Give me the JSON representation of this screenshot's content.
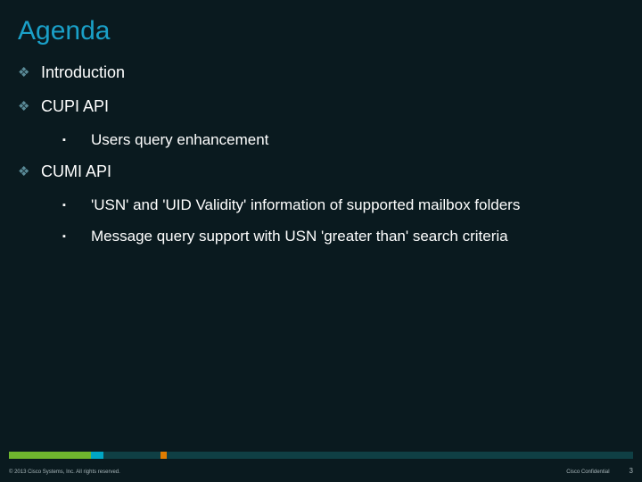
{
  "title": "Agenda",
  "items": [
    {
      "label": "Introduction"
    },
    {
      "label": "CUPI API",
      "children": [
        {
          "label": "Users query enhancement"
        }
      ]
    },
    {
      "label": "CUMI API",
      "children": [
        {
          "label": "'USN' and 'UID Validity' information of supported mailbox folders"
        },
        {
          "label": "Message query support with USN 'greater than' search criteria"
        }
      ]
    }
  ],
  "footer": {
    "copyright": "© 2013 Cisco Systems, Inc. All rights reserved.",
    "confidential": "Cisco Confidential",
    "page": "3"
  }
}
